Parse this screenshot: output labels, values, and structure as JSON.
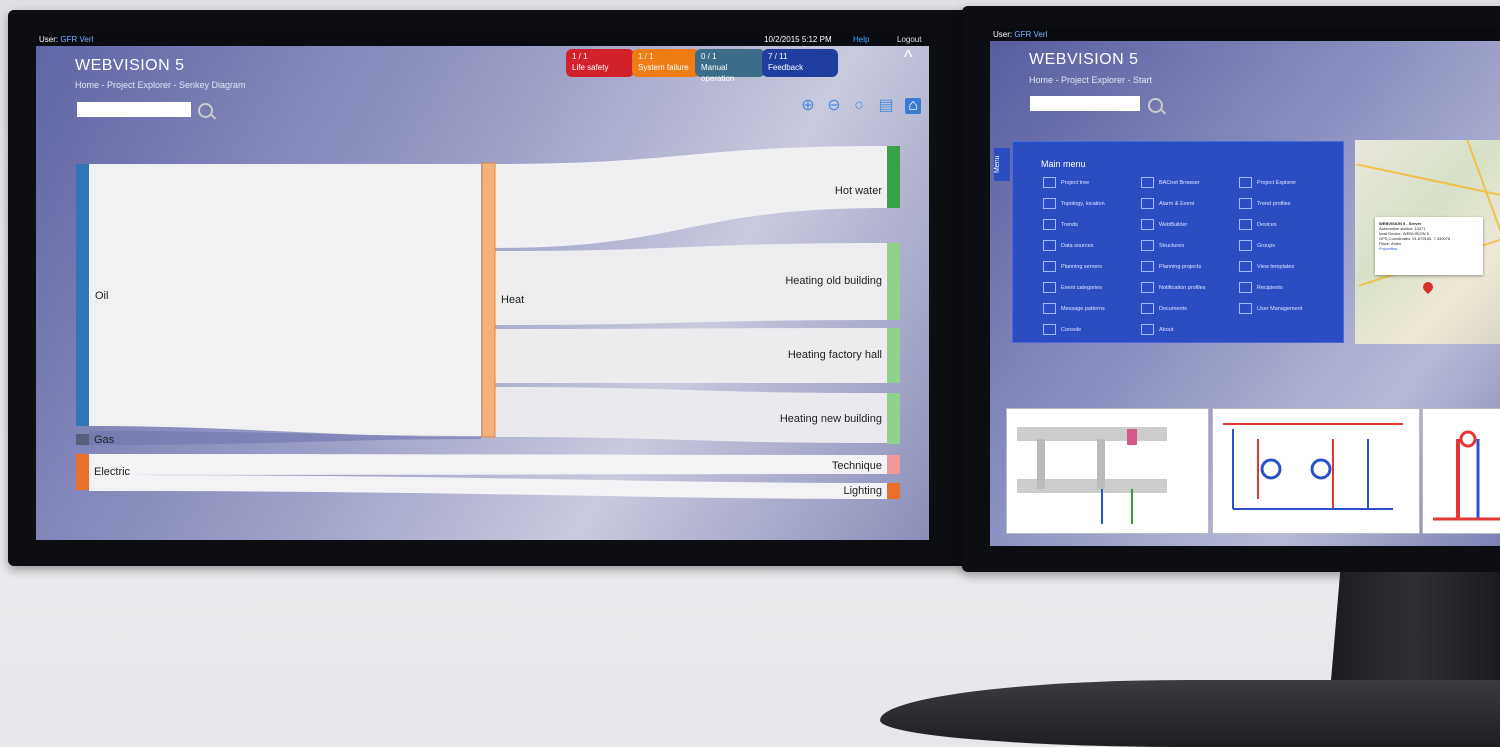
{
  "left_screen": {
    "user_label": "User:",
    "user_name": "GFR Verl",
    "datetime": "10/2/2015  5:12 PM",
    "help": "Help",
    "logout": "Logout",
    "brand": "WEBVISION 5",
    "breadcrumb": "Home - Project Explorer - Senkey Diagram",
    "alarms": [
      {
        "count": "1 / 1",
        "label": "Life safety",
        "color": "#d3212b"
      },
      {
        "count": "1 / 1",
        "label": "System failure",
        "color": "#f07c14"
      },
      {
        "count": "0 / 1",
        "label": "Manual operation",
        "color": "#3b6d8a"
      },
      {
        "count": "7 / 11",
        "label": "Feedback",
        "color": "#1f3f9f"
      }
    ],
    "toolbar_icons": [
      "zoom-in-icon",
      "zoom-out-icon",
      "zoom-reset-icon",
      "comment-icon",
      "home-icon"
    ]
  },
  "sankey": {
    "sources": [
      {
        "label": "Oil",
        "color": "#2f78b8"
      },
      {
        "label": "Gas",
        "color": "#555555"
      },
      {
        "label": "Electric",
        "color": "#e8702a"
      }
    ],
    "middle": {
      "label": "Heat",
      "color": "#f3b27a"
    },
    "targets": [
      {
        "label": "Hot water",
        "color": "#3aa14a"
      },
      {
        "label": "Heating old building",
        "color": "#8ed28c"
      },
      {
        "label": "Heating factory hall",
        "color": "#8ed28c"
      },
      {
        "label": "Heating new building",
        "color": "#8ed28c"
      },
      {
        "label": "Technique",
        "color": "#ee9a9a"
      },
      {
        "label": "Lighting",
        "color": "#e8702a"
      }
    ]
  },
  "right_screen": {
    "user_label": "User:",
    "user_name": "GFR Verl",
    "brand": "WEBVISION 5",
    "breadcrumb": "Home - Project Explorer - Start",
    "menu_tab": "Menu",
    "main_menu_title": "Main menu",
    "menu_items": [
      "Project tree",
      "BACnet Browser",
      "Project Explorer",
      "Topology, location",
      "Alarm & Event",
      "Trend profiles",
      "Trends",
      "WebBuilder",
      "Devices",
      "Data sources",
      "Structures",
      "Groups",
      "Planning servers",
      "Planning projects",
      "View templates",
      "Event categories",
      "Notification profiles",
      "Recipients",
      "Message patterns",
      "Documents",
      "User Management",
      "Console",
      "About"
    ],
    "map_popup": {
      "title": "WEBVISION 5 - Server",
      "lines": [
        "Automation station: 10471",
        "local Device: WEBVISION 5",
        "GPS Coordinates: 51.879100, 7.330078",
        "Place: Ahlen"
      ],
      "link": "Properties"
    }
  }
}
